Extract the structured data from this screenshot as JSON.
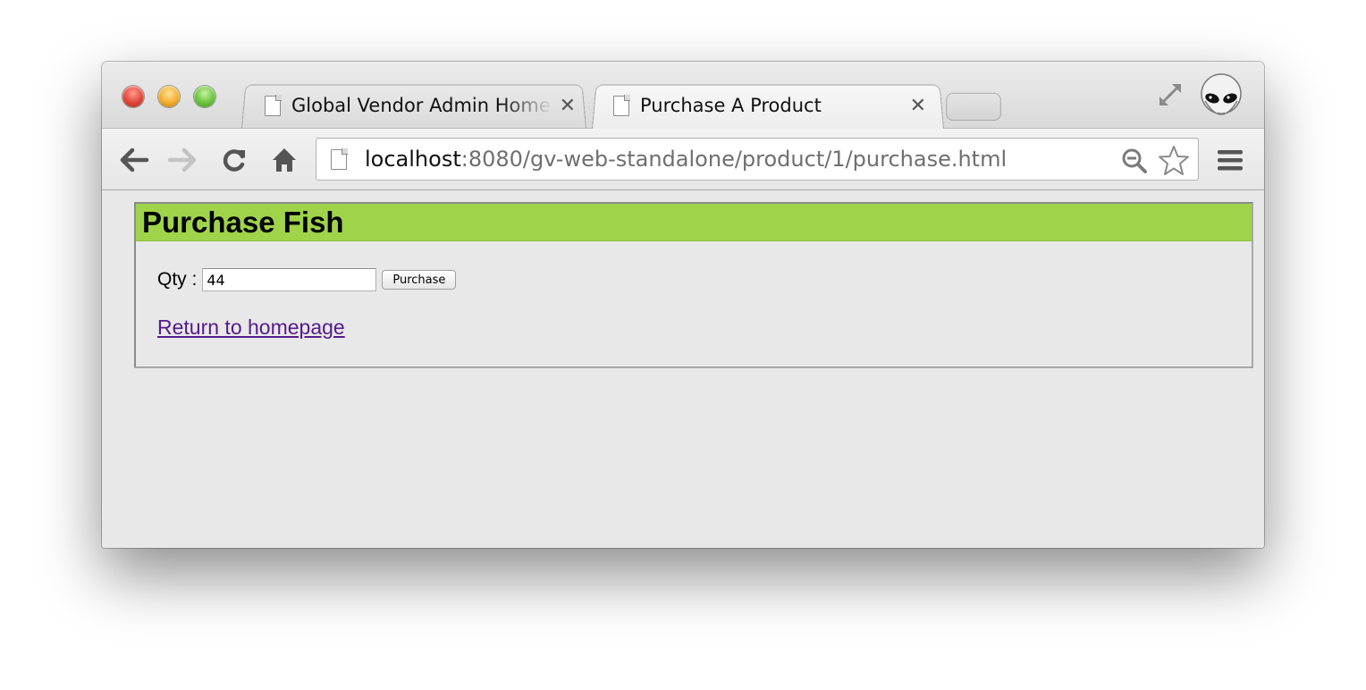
{
  "browser": {
    "tabs": [
      {
        "title": "Global Vendor Admin Home",
        "active": false
      },
      {
        "title": "Purchase A Product",
        "active": true
      }
    ],
    "url": {
      "host": "localhost",
      "rest": ":8080/gv-web-standalone/product/1/purchase.html"
    },
    "icons": {
      "close": "✕",
      "back": "arrow-left-icon",
      "forward": "arrow-right-icon",
      "reload": "reload-icon",
      "home": "home-icon",
      "zoom": "zoom-out-icon",
      "bookmark": "star-icon",
      "menu": "hamburger-menu-icon",
      "fullscreen": "fullscreen-icon",
      "profile": "alien-avatar-icon"
    }
  },
  "page": {
    "title": "Purchase Fish",
    "qty_label": "Qty :",
    "qty_value": "44",
    "purchase_button": "Purchase",
    "home_link": "Return to homepage",
    "colors": {
      "header_bg": "#9fd34a",
      "page_bg": "#e8e8e8",
      "link": "#551a8b"
    }
  }
}
